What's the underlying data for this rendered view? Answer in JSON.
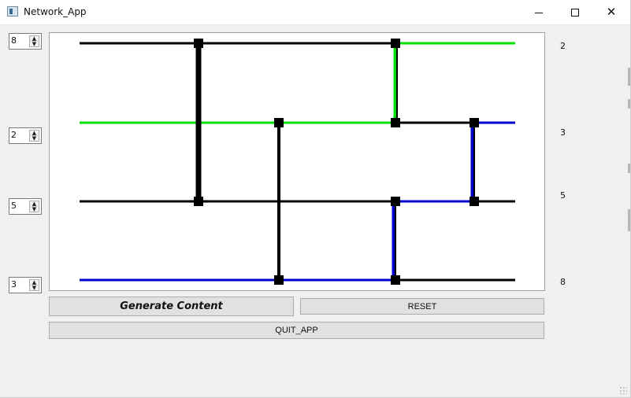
{
  "window": {
    "title": "Network_App"
  },
  "controls": {
    "spin_values": [
      "8",
      "2",
      "5",
      "3"
    ],
    "right_labels": [
      "2",
      "3",
      "5",
      "8"
    ]
  },
  "buttons": {
    "generate": "Generate Content",
    "reset": "RESET",
    "quit": "QUIT_APP"
  },
  "titlebar_buttons": {
    "close": "✕"
  },
  "colors": {
    "green": "#00e000",
    "blue": "#0000cc",
    "black": "#000000"
  }
}
